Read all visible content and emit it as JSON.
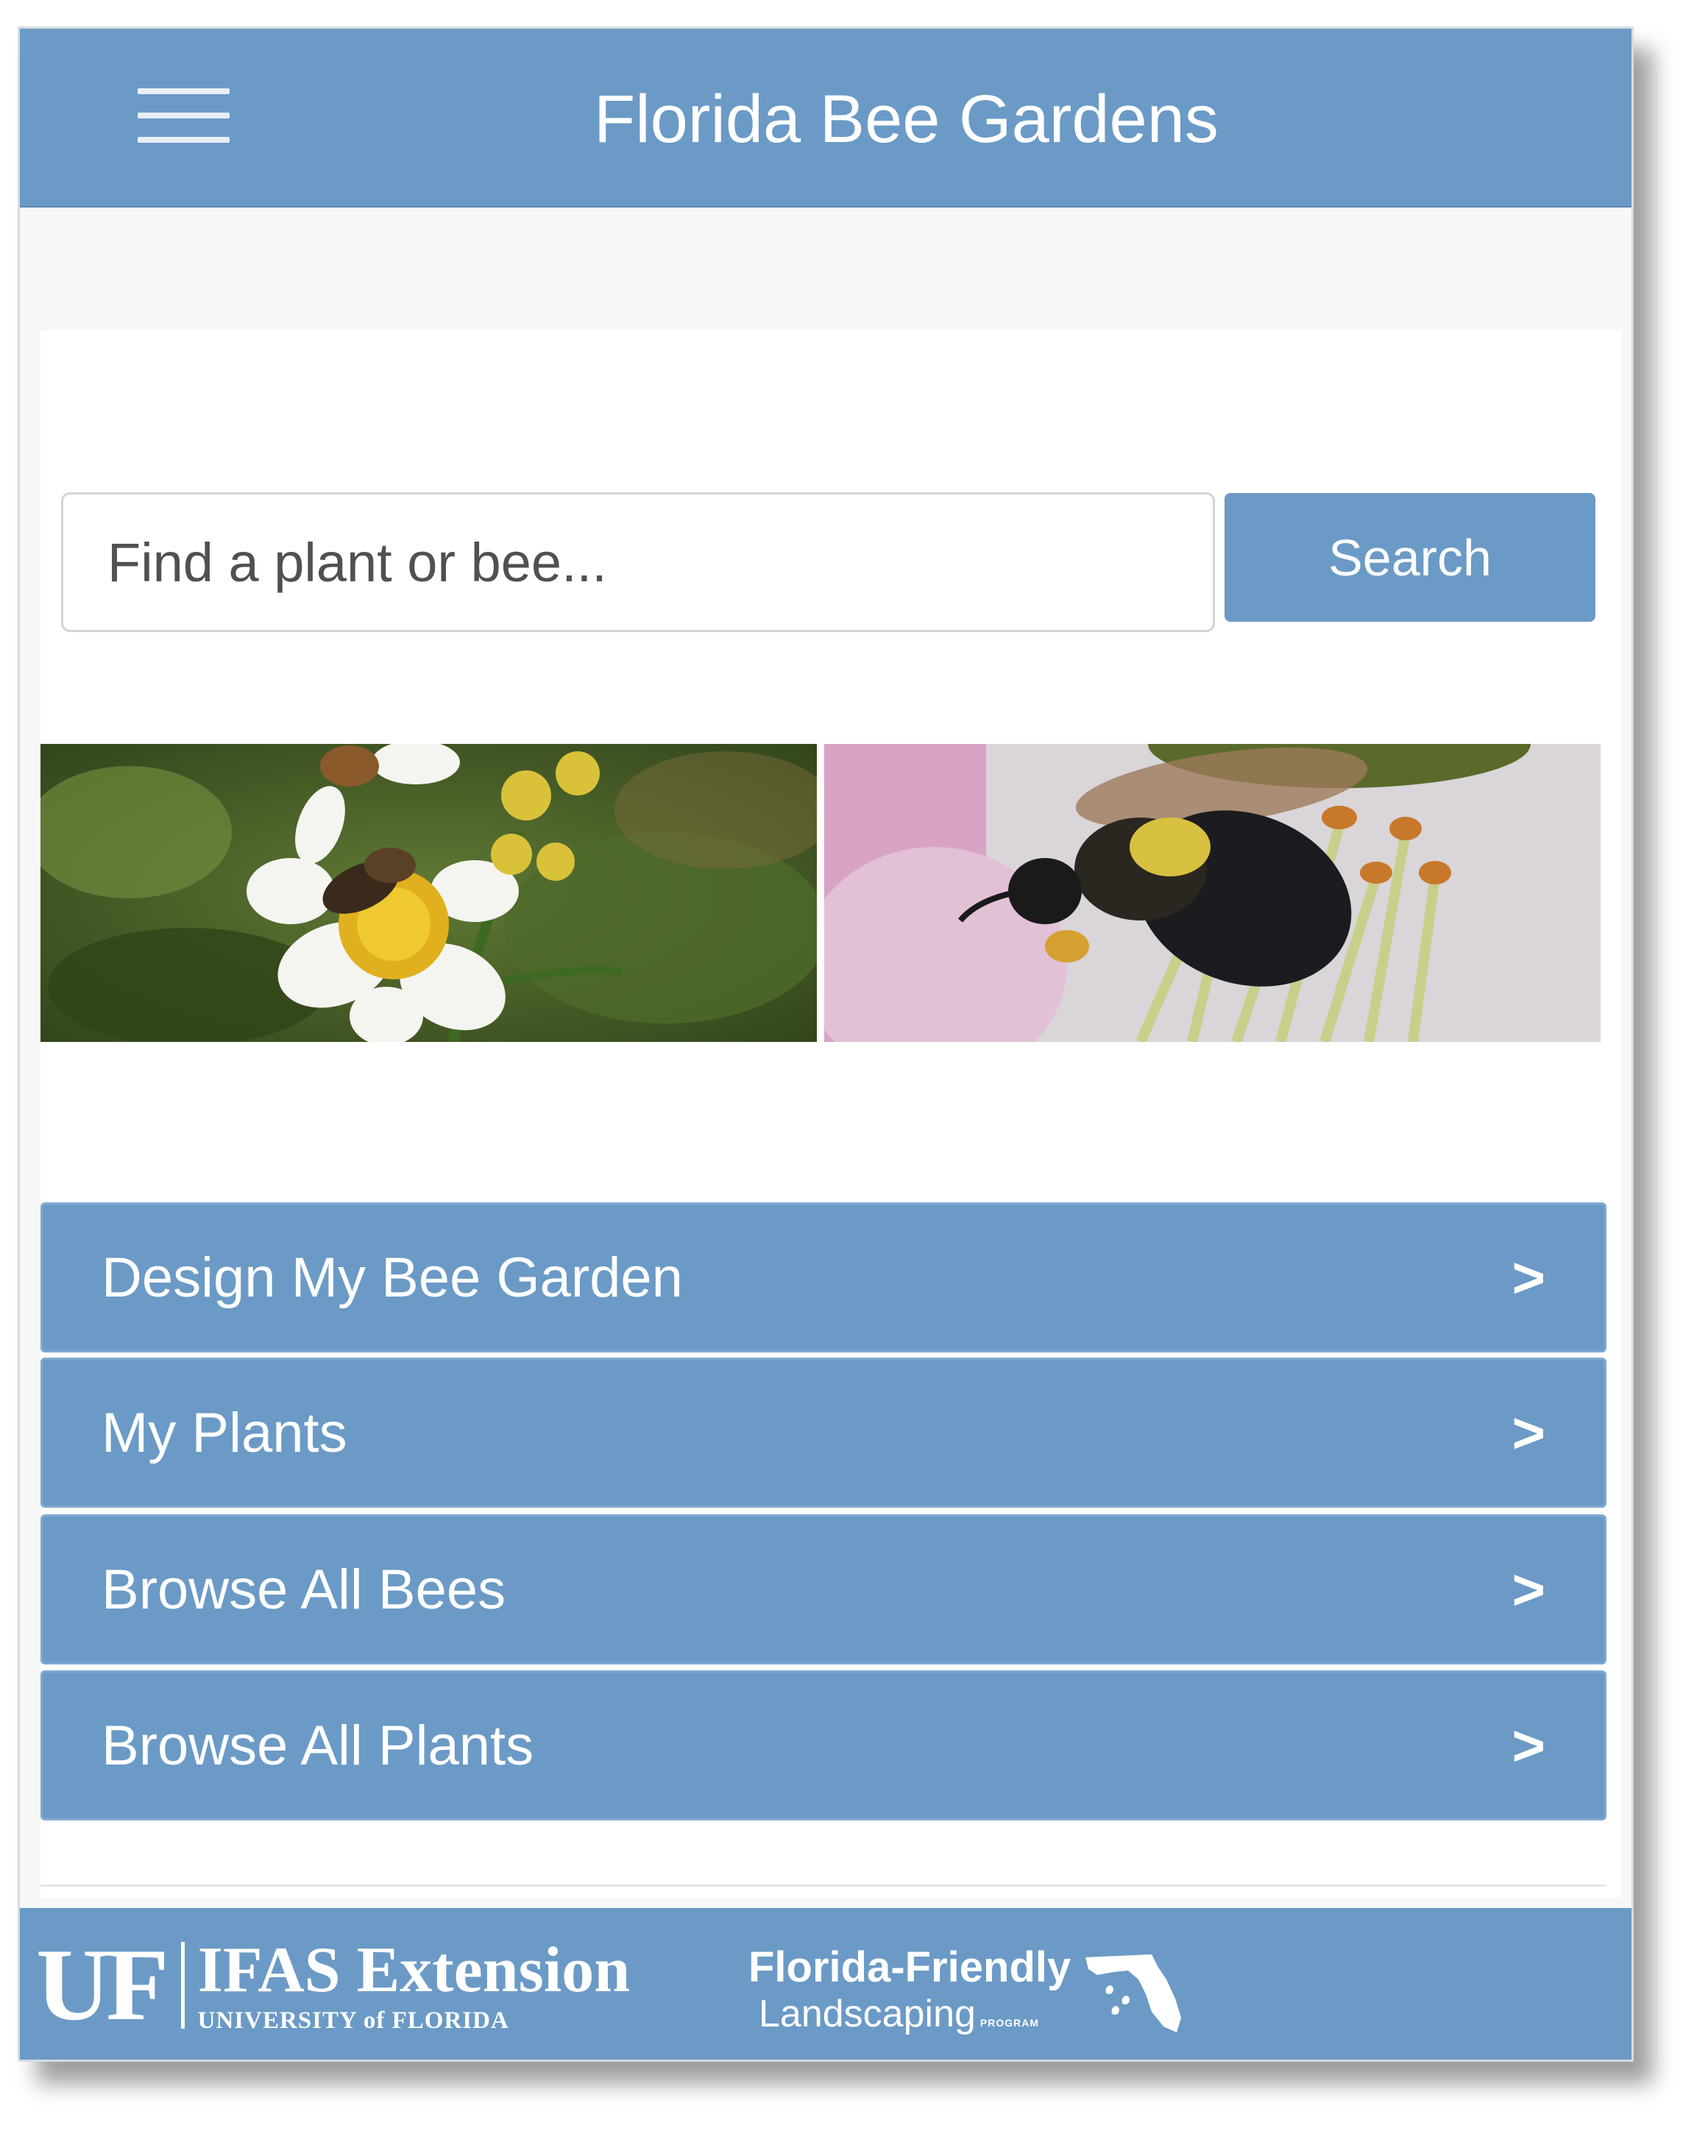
{
  "header": {
    "title": "Florida Bee Gardens",
    "menu_icon": "hamburger-menu-icon"
  },
  "search": {
    "placeholder": "Find a plant or bee...",
    "button_label": "Search"
  },
  "nav": {
    "items": [
      {
        "label": "Design My Bee Garden",
        "chevron": ">"
      },
      {
        "label": "My Plants",
        "chevron": ">"
      },
      {
        "label": "Browse All Bees",
        "chevron": ">"
      },
      {
        "label": "Browse All Plants",
        "chevron": ">"
      }
    ]
  },
  "footer": {
    "uf_mark": "UF",
    "ifas_title": "IFAS Extension",
    "ifas_sub": "UNIVERSITY of FLORIDA",
    "ffl_line1": "Florida-Friendly",
    "ffl_line2": "Landscaping",
    "ffl_program": "PROGRAM"
  },
  "colors": {
    "primary": "#6b9ac6",
    "page_background": "#f7f7f7",
    "text_on_primary": "#ffffff"
  }
}
